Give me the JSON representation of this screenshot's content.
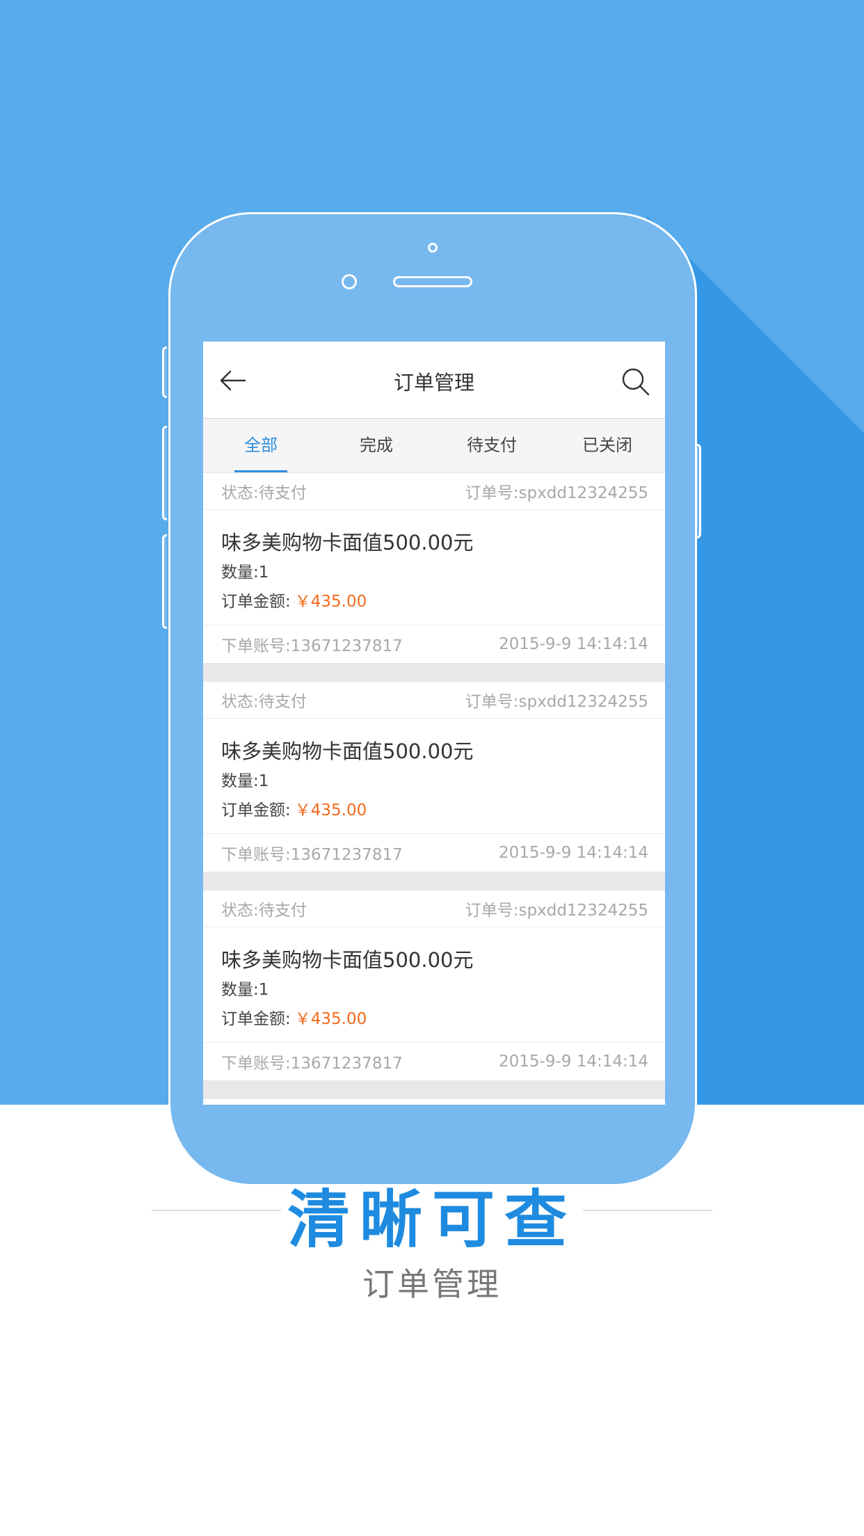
{
  "app": {
    "title": "订单管理",
    "tabs": [
      "全部",
      "完成",
      "待支付",
      "已关闭"
    ],
    "active_tab": "全部"
  },
  "orders": [
    {
      "status": "状态:待支付",
      "order_no": "订单号:spxdd12324255",
      "product": "味多美购物卡面值500.00元",
      "qty": "数量:1",
      "amount_label": "订单金额:",
      "amount_value": "￥435.00",
      "account": "下单账号:13671237817",
      "time": "2015-9-9 14:14:14"
    },
    {
      "status": "状态:待支付",
      "order_no": "订单号:spxdd12324255",
      "product": "味多美购物卡面值500.00元",
      "qty": "数量:1",
      "amount_label": "订单金额:",
      "amount_value": "￥435.00",
      "account": "下单账号:13671237817",
      "time": "2015-9-9 14:14:14"
    },
    {
      "status": "状态:待支付",
      "order_no": "订单号:spxdd12324255",
      "product": "味多美购物卡面值500.00元",
      "qty": "数量:1",
      "amount_label": "订单金额:",
      "amount_value": "￥435.00",
      "account": "下单账号:13671237817",
      "time": "2015-9-9 14:14:14"
    }
  ],
  "caption": {
    "title": "清晰可查",
    "subtitle": "订单管理"
  },
  "icons": {
    "back": "arrow-left-icon",
    "search": "search-icon"
  },
  "colors": {
    "background_blue": "#58acec",
    "accent": "#2d8ee0",
    "price": "#f26a1d",
    "caption_title": "#1e8be0"
  }
}
